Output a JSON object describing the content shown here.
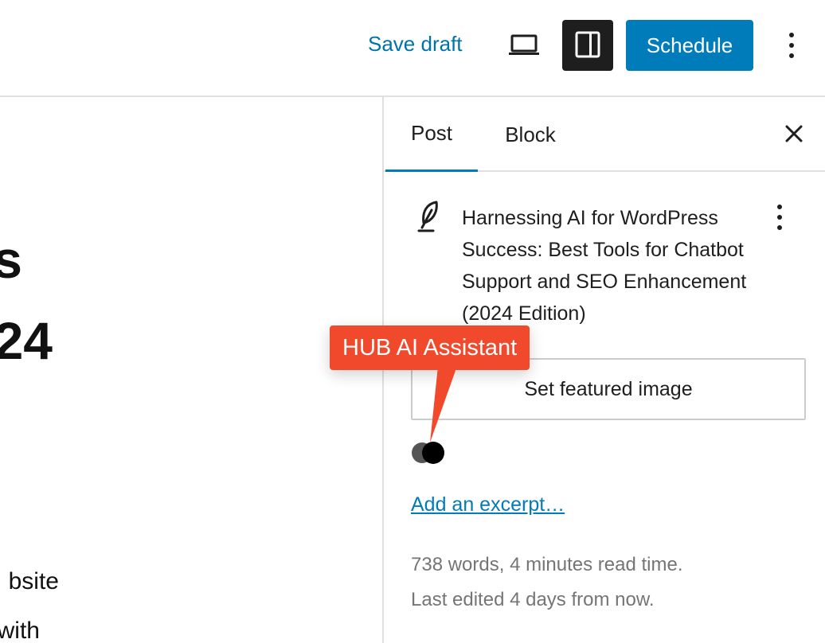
{
  "toolbar": {
    "save_draft_label": "Save draft",
    "preview_icon": "laptop-icon",
    "settings_icon": "sidebar-toggle-icon",
    "schedule_label": "Schedule",
    "more_icon": "vertical-ellipsis-icon"
  },
  "canvas": {
    "title_line_1": "s",
    "title_line_2": "24",
    "body_line_1": "bsite",
    "body_line_2": "with"
  },
  "sidebar": {
    "tabs": [
      {
        "label": "Post",
        "active": true
      },
      {
        "label": "Block",
        "active": false
      }
    ],
    "close_icon": "close-icon",
    "post_icon": "feather-icon",
    "post_title": "Harnessing AI for WordPress Success: Best Tools for Chatbot Support and SEO Enhancement (2024 Edition)",
    "post_more_icon": "vertical-ellipsis-icon",
    "featured_image_label": "Set featured image",
    "ai_indicator_icon": "ai-dots-icon",
    "excerpt_label": "Add an excerpt…",
    "word_count": "738 words, 4 minutes read time.",
    "last_edited": "Last edited 4 days from now."
  },
  "callout": {
    "label": "HUB AI Assistant",
    "color": "#f0492b"
  },
  "colors": {
    "accent": "#007cba",
    "link": "#0073aa",
    "dark_button": "#1e1e1e",
    "muted_text": "#757575"
  }
}
